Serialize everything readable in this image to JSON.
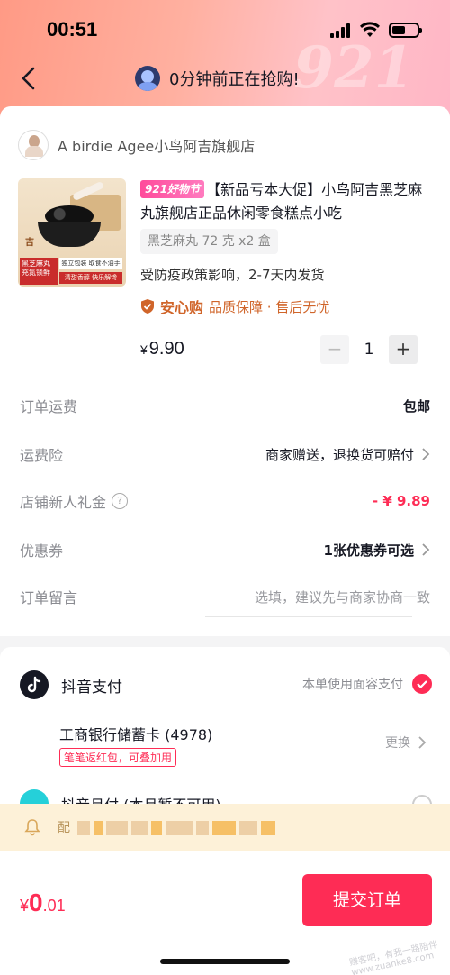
{
  "status_bar": {
    "time": "00:51"
  },
  "nav": {
    "title": "0分钟前正在抢购!"
  },
  "header_watermark": "921",
  "shop": {
    "name": "A birdie Agee小鸟阿吉旗舰店"
  },
  "product": {
    "festival_badge": "921好物节",
    "title": "【新品亏本大促】小鸟阿吉黑芝麻丸旗舰店正品休闲零食糕点小吃",
    "spec": "黑芝麻丸 72 克 x2 盒",
    "shipping_note": "受防疫政策影响，2-7天内发货",
    "assure_brand": "安心购",
    "assure_text": "品质保障 · 售后无忧",
    "price_symbol": "¥",
    "price": "9.90",
    "quantity": "1",
    "image": {
      "label_left": "黑芝麻丸 充氮锁鲜",
      "tag1": "独立包装 取食不油手",
      "tag2": "清甜香醇 快乐解馋",
      "seal": "吉"
    }
  },
  "order_rows": [
    {
      "label": "订单运费",
      "value": "包邮"
    },
    {
      "label": "运费险",
      "value": "商家赠送，退换货可赔付"
    },
    {
      "label": "店铺新人礼金",
      "value": "- ¥ 9.89"
    },
    {
      "label": "优惠券",
      "value": "1张优惠券可选"
    },
    {
      "label": "订单留言",
      "placeholder": "选填，建议先与商家协商一致"
    }
  ],
  "payment": {
    "method": "抖音支付",
    "face_pay": "本单使用面容支付",
    "bank_card": "工商银行储蓄卡 (4978)",
    "bank_promo": "笔笔返红包，可叠加用",
    "change": "更换",
    "monthly": "抖音月付 (本月暂不可用)"
  },
  "notice": {
    "text": "配"
  },
  "footer": {
    "total_symbol": "¥",
    "total_int": "0",
    "total_dec": ".01",
    "submit": "提交订单",
    "watermark": "赚客吧，有我一路陪伴 www.zuanke8.com"
  },
  "colors": {
    "accent": "#fe2c55",
    "assure": "#d0652a",
    "notice_bg": "#fdf1d8"
  }
}
